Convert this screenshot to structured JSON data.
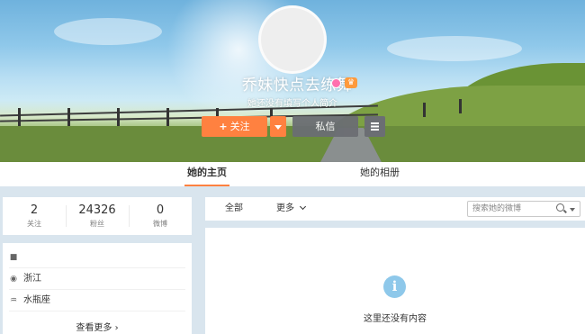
{
  "profile": {
    "name": "乔妹快点去练舞",
    "intro": "她还没有填写个人简介",
    "badge_icon": "vip-heart-icon",
    "member_icon": "member-crown-icon"
  },
  "actions": {
    "follow_label": "关注",
    "follow_icon": "+",
    "message_label": "私信",
    "menu_icon": "hamburger-menu-icon"
  },
  "tabs": [
    {
      "label": "她的主页",
      "active": true
    },
    {
      "label": "她的相册",
      "active": false
    }
  ],
  "stats": [
    {
      "value": "2",
      "label": "关注"
    },
    {
      "value": "24326",
      "label": "粉丝"
    },
    {
      "value": "0",
      "label": "微博"
    }
  ],
  "info": {
    "rows": [
      {
        "icon": "bookmark-icon",
        "text": ""
      },
      {
        "icon": "location-pin-icon",
        "text": "浙江"
      },
      {
        "icon": "zodiac-icon",
        "text": "水瓶座"
      }
    ],
    "more_label": "查看更多",
    "more_arrow": "›"
  },
  "feed": {
    "tabs": [
      {
        "label": "全部"
      },
      {
        "label": "更多"
      }
    ],
    "search_placeholder": "搜索她的微博",
    "empty_text": "这里还没有内容",
    "empty_icon": "i"
  },
  "colors": {
    "accent": "#ff8140",
    "info": "#8ec8ea",
    "page_bg": "#d9e5ee"
  }
}
